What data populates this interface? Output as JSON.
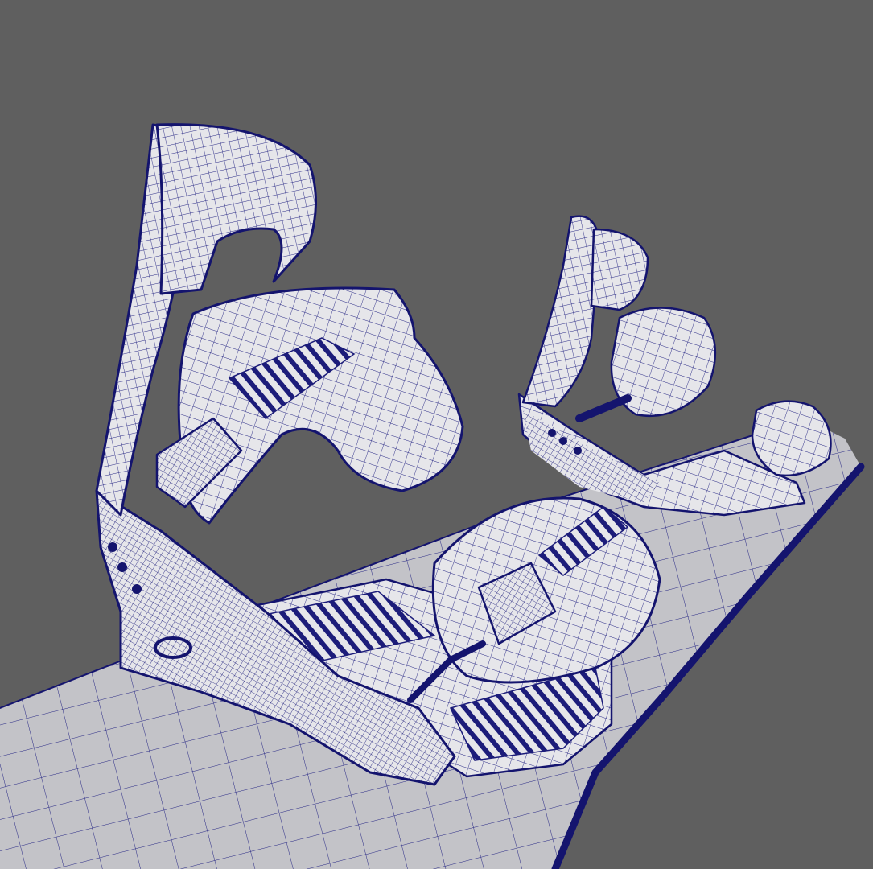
{
  "viewport": {
    "background_color": "#5f5f5f",
    "wire_color": "#2a2a86",
    "wire_dark_color": "#14146e",
    "surface_color": "#e6e6ea",
    "surface_shadow_color": "#b9b9c2",
    "board_color": "#c3c3c8"
  },
  "scene": {
    "subject_icon": "snowboard-binding-wireframe-icon",
    "objects": [
      "snowboard-deck",
      "rear-binding",
      "front-binding"
    ]
  }
}
